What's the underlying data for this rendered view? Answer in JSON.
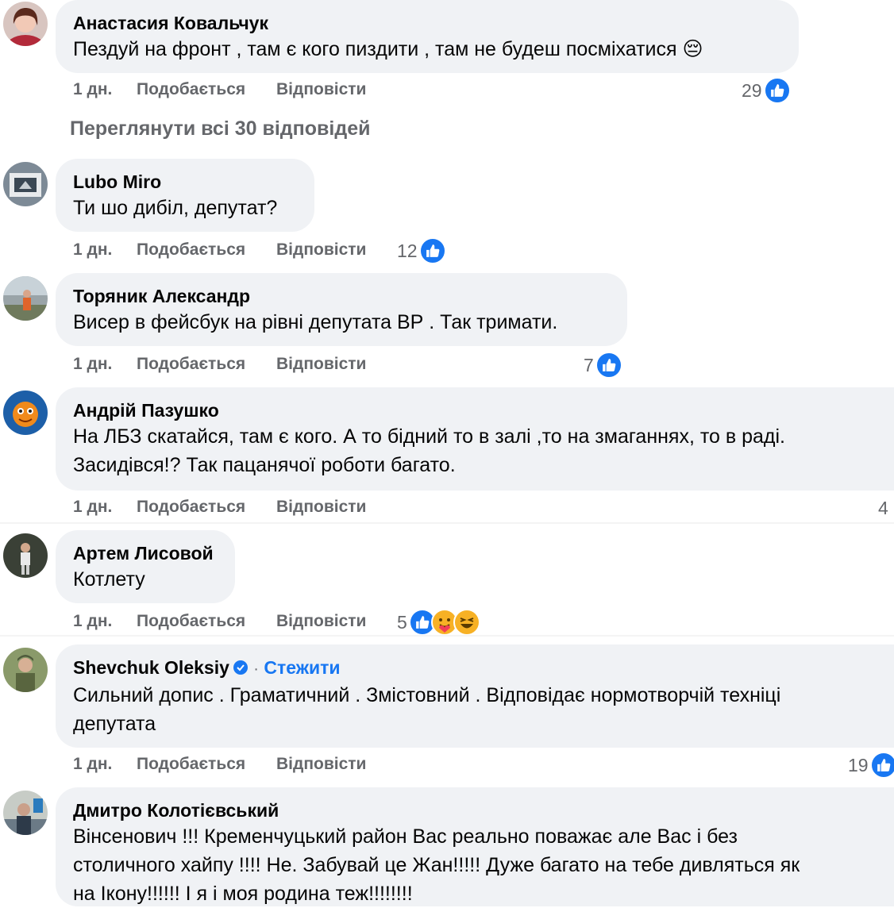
{
  "colors": {
    "bubble_bg": "#f0f2f5",
    "meta_text": "#65676b",
    "like_blue": "#1877f2",
    "follow_blue": "#1877f2"
  },
  "view_all_replies": "Переглянути всі 30 відповідей",
  "comments": [
    {
      "author": "Анастасия Ковальчук",
      "text": "Пездуй на фронт , там є кого пиздити , там не будеш посміхатися 😔",
      "time": "1 дн.",
      "like_label": "Подобається",
      "reply_label": "Відповісти",
      "reactions_count": "29",
      "reaction_icons": [
        "like-icon"
      ]
    },
    {
      "author": "Lubo Miro",
      "text": "Ти шо дибіл, депутат?",
      "time": "1 дн.",
      "like_label": "Подобається",
      "reply_label": "Відповісти",
      "reactions_count": "12",
      "reaction_icons": [
        "like-icon"
      ]
    },
    {
      "author": "Торяник Александр",
      "text": "Висер в фейсбук на рівні депутата ВР . Так тримати.",
      "time": "1 дн.",
      "like_label": "Подобається",
      "reply_label": "Відповісти",
      "reactions_count": "7",
      "reaction_icons": [
        "like-icon"
      ]
    },
    {
      "author": "Андрій Пазушко",
      "text": "На ЛБЗ скатайся, там є кого. А то бідний то в залі ,то на змаганнях, то в раді.\nЗасидівся!? Так пацанячої роботи багато.",
      "time": "1 дн.",
      "like_label": "Подобається",
      "reply_label": "Відповісти",
      "reactions_count": "4",
      "reaction_icons": []
    },
    {
      "author": "Артем Лисовой",
      "text": "Котлету",
      "time": "1 дн.",
      "like_label": "Подобається",
      "reply_label": "Відповісти",
      "reactions_count": "5",
      "reaction_icons": [
        "like-icon",
        "care-icon",
        "haha-icon"
      ]
    },
    {
      "author": "Shevchuk Oleksiy",
      "separator": "·",
      "follow_label": "Стежити",
      "text": "Сильний допис . Граматичний . Змістовний . Відповідає нормотворчій техніці\nдепутата",
      "time": "1 дн.",
      "like_label": "Подобається",
      "reply_label": "Відповісти",
      "reactions_count": "19",
      "reaction_icons": [
        "like-icon"
      ]
    },
    {
      "author": "Дмитро Колотієвський",
      "text": "Вінсенович !!! Кременчуцький район Вас реально поважає але Вас і без\nстоличного хайпу !!!! Не. Забувай це Жан!!!!! Дуже багато на тебе дивляться як\nна Ікону!!!!!! І я і моя родина теж!!!!!!!!"
    }
  ]
}
